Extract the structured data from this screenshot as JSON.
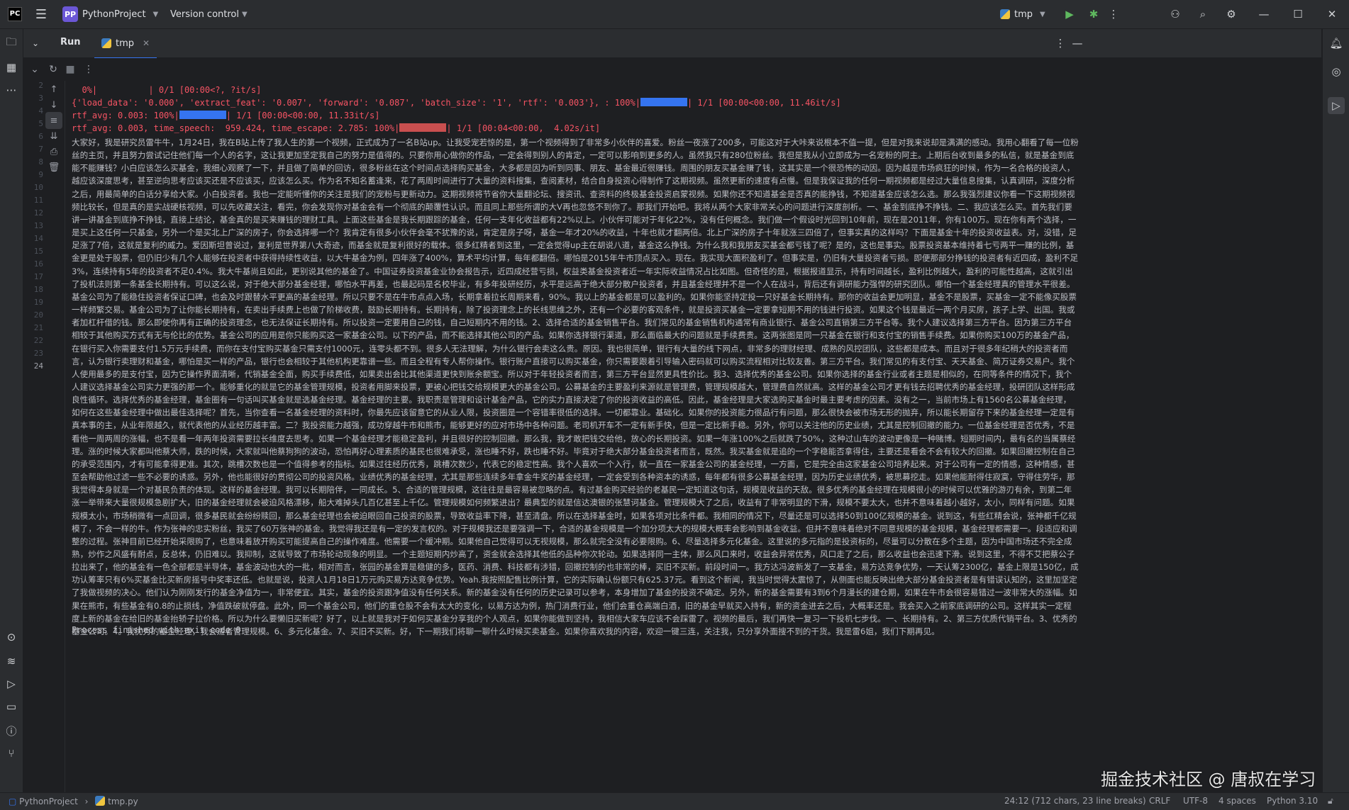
{
  "titlebar": {
    "project_badge": "PP",
    "project_name": "PythonProject",
    "version_control": "Version control",
    "run_config": "tmp"
  },
  "toolwindow": {
    "title": "Run",
    "tab_label": "tmp"
  },
  "line_numbers": [
    "2",
    "3",
    "4",
    "5",
    "6",
    "7",
    "8",
    "9",
    "10",
    "11",
    "12",
    "13",
    "14",
    "15",
    "16",
    "17",
    "18",
    "19",
    "20",
    "21",
    "22",
    "23",
    "24"
  ],
  "console": {
    "progress_line": "  0%|          | 0/1 [00:00<?, ?it/s]",
    "dict_line": "{'load_data': '0.000', 'extract_feat': '0.007', 'forward': '0.087', 'batch_size': '1', 'rtf': '0.003'}, : 100%|",
    "dict_line_end": "| 1/1 [00:00<00:00, 11.46it/s]",
    "rtf_line_1": "rtf_avg: 0.003: 100%|",
    "rtf_line_1_end": "| 1/1 [00:00<00:00, 11.33it/s]",
    "rtf_line_2": "rtf_avg: 0.003, time_speech:  959.424, time_escape: 2.785: 100%|",
    "rtf_line_2_end": "| 1/1 [00:04<00:00,  4.02s/it]",
    "transcript": "大家好，我是研究员雷牛牛，1月24日，我在B站上传了我人生的第一个视频，正式成为了一名B站up。让我受宠若惊的是，第一个视频得到了非常多小伙伴的喜爱。粉丝一夜涨了200多，可能这对于大咔来说根本不值一提，但是对我来说却是满满的感动。我用心翻看了每一位粉丝的主页，并且努力尝试记住他们每一个人的名字，这让我更加坚定我自己的努力是值得的。只要你用心做你的作品，一定会得到别人的肯定，一定可以影响到更多的人。虽然我只有280位粉丝。我但是我从小立即成为一名宠粉的阿主。上期后台收到最多的私信，就是基金到底能不能赚钱？小白应该怎么买基金，我细心观察了一下，并且做了简单的回访，很多粉丝在这个时间点选择购买基金，大多都是因为听到同事、朋友、基金最近很赚钱。周围的朋友买基金赚了钱，这其实是一个很恐怖的动因。因为越是市场疯狂的时候，作为一名合格的投资人，越应该深度思考，甚至逆向思考应该买还是不应该买，应该怎么买。作为名不知名蓄逢来，花了两周时间进行了大量的资料搜集，查阅素材，结合自身投资心得制作了这期视频。虽然更新的速度有点慢。但是我保证我的任何一期视频都是经过大量信息搜集，认真调研，深度分析之后，用最简单的白话分享给大家。小白投资者。我也一定能听懂你的关注是我们的宠粉与更新动力。这期视频将节省你大量翻论坛、搜资讯、查资料的终极基金投资启蒙视频。如果你还不知道基金是否真的能挣钱，不知道基金应该怎么选。那么我强烈建议你看一下这期视频视频比较长，但是真的是实战硬核视频，可以先收藏关注，看完，你会发现你对基金会有一个彻底的颠覆性认识。而且同上那些所谓的大V再也忽悠不到你了。那我们开始吧。我将从两个大家非常关心的问题进行深度剖析。一、基金到底挣不挣钱。二、我应该怎么买。首先我们要讲一讲基金到底挣不挣钱，直接上结论，基金真的是买来赚钱的理财工具。上面这些基金是我长期跟踪的基金，任何一支年化收益都有22%以上。小伙伴可能对于年化22%，没有任何概念。我们做一个假设时光回到10年前，现在是2011年，你有100万。现在你有两个选择，一是买上这任何一只基金，另外一个是买北上广深的房子，你会选择哪一个？我肯定有很多小伙伴会毫不犹豫的说，肯定是房子呀，基金一年才20%的收益，十年也就才翻两倍。北上广深的房子十年就涨三四倍了，但事实真的这样吗？下面是基金十年的投资收益表。对，没错，足足涨了7倍，这就是复利的威力。爱因斯坦曾说过，复利是世界第八大奇迹，而基金就是复利很好的载体。很多红精者到这里，一定会觉得up主在胡说八道，基金这么挣钱。为什么我和我朋友买基金都亏钱了呢？是的，这也是事实。股票投资基本维持着七亏两平一赚的比例，基金更是处于股票，但仍旧少有几个人能够在投资者中获得持续性收益，以大牛基金为例，四年涨了400%，算术平均计算，每年都翻倍。哪怕是2015年牛市顶点买入。现在。我实现大面积盈利了。但事实是，仍旧有大量投资者亏损。即便那部分挣钱的投资者有近四成，盈利不足3%，连续持有5年的投资者不足0.4%。我大牛基尚且如此，更别说其他的基金了。中国证券投资基金业协会报告示，近四成经营亏损，权益类基金投资者近一年实际收益情况占比如图。但奇怪的是，根据报道显示，持有时间越长，盈利比例越大，盈利的可能性越高，这就引出了投机法则第一条基金长期持有。可以这么说，对于绝大部分基金经理，哪怕水平再差，也最起码是名校毕业，有多年投研经历，水平是远高于绝大部分散户投资者，并且基金经理并不是一个人在战斗，背后还有调研能力强悍的研究团队。哪怕一个基金经理真的管理水平很差。基金公司为了能稳住投资者保证口碑，也会及时跟替水平更高的基金经理。所以只要不是在牛市点点入场，长期拿着拉长周期来看，90%。我以上的基金都是可以盈利的。如果你能坚持定投一只好基金长期持有。那你的收益会更加明显，基金不是股票，买基金一定不能像买股票一样频繁交易。基金公司为了让你能长期持有，在卖出手续费上也做了阶梯收费，鼓励长期持有。长期持有，除了投资理念上的长线思维之外，还有一个必要的客观条件，就是投资买基金一定要拿短期不用的钱进行投资。如果这个钱是最近一两个月买房，孩子上学、出国。我或者加杠杆借的钱。那么即使你再有正确的投资理念，也无法保证长期持有。所以投资一定要用自己的钱，自己短期内不用的钱。2、选择合适的基金销售平台。我们常见的基金销售机构通常有商业银行、基金公司直销第三方平台等。我个人建议选择第三方平台。因为第三方平台相较于其他购买方式有无与伦比的优势。基金公司的应用是你只能购买这一家基金公司。以下的产品，而不能选择其他公司的产品。如果你选择银行渠道，那么面临最大的问题就是手续费贵。这两张图是同一只基金在银行和支付宝的销售手续费。如果你购买100万的基金产品，在银行买入你需要支付1.5万元手续费，而你在支付宝购买基金只需支付1000元，连零头都不到。很多人无法理解，为什么银行会卖这么贵。原因。我也很简单，银行有大量的线下网点，非常多的理财经理、成熟的风控团队，这些都是成本。而且对于很多年纪稍大的投资者而言，认为银行卖理财和基金，哪怕是买一样的产品，银行也会相较于其他机构更靠谱一些。而且全程有专人帮你操作。银行账户直接可以购买基金，你只需要跟着引导输入密码就可以购买流程相对比较友善。第三方平台。我们常见的有支付宝、天天基金、简万证券交易户。我个人使用最多的是支付宝，因为它操作界面清晰，代销基金全面，购买手续费低，如果卖出会比其他渠道更快到账余额宝。所以对于年轻投资者而言，第三方平台显然更具性价比。我3、选择优秀的基金公司。如果你选择的基金行业或者主题是相似的，在同等条件的情况下，我个人建议选择基金公司实力更强的那一个。能够重化的就是它的基金管理规模，投资者用脚来投票，更被心把钱交给规模更大的基金公司。公募基金的主要盈利来源就是管理费，管理规模越大，管理费自然就高。这样的基金公司才更有钱去招聘优秀的基金经理，投研团队这样形成良性循环。选择优秀的基金经理，基金圈有一句话叫买基金就是选基金经理。基金经理的主要。我职责是管理和设计基金产品，它的实力直接决定了你的投资收益的高低。因此，基金经理是大家选购买基金时最主要考虑的因素。没有之一，当前市场上有1560名公募基金经理，如何在这些基金经理中做出最佳选择呢？首先，当你查看一名基金经理的资料时，你最先应该留意它的从业人限，投资圈是一个容错率很低的选择。一切都靠业。基础化。如果你的投资能力很品行有问题，那么很快会被市场无形的抛弃，所以能长期留存下来的基金经理一定是有真本事的主，从业年限越久，就代表他的从业经历越丰富。二？我投资能力越强，成功穿越牛市和熊市，能够更好的应对市场中各种问题。老司机开车不一定有新手快，但是一定比新手稳。另外，你可以关注他的历史业绩，尤其是控制回撤的能力。一位基金经理是否优秀，不是看他一周两周的涨幅，也不是看一年两年投资需要拉长维度去思考。如果一个基金经理才能稳定盈利，并且很好的控制回撤。那么我，我才敢把钱交给他，放心的长期投资。如果一年涨100%之后就跌了50%，这种过山车的波动更像是一种赌博。短期时间内，最有名的当属蔡经理。涨的时候大家都叫他蔡大师，跌的时候，大家就叫他蔡狗狗的波动，恐怕再好心理素质的基民也很难承受，涨也睡不好，跌也睡不好。毕竟对于绝大部分基金投资者而言，既然。我买基金就是追的一个字稳能否拿得住，主要还是看会不会有较大的回撤。如果回撤控制在自己的承受范围内，才有可能拿得更准。其次，跳槽次数也是一个值得参考的指标。如果过往经历优秀，跳槽次数少，代表它的稳定性高。我个人喜欢一个入行，就一直在一家基金公司的基金经理，一方面，它是完全由这家基金公司培养起来。对于公司有一定的情感，这种情感，甚至会帮助他过滤一些不必要的诱惑。另外，他也能很好的贯彻公司的投资风格。业绩优秀的基金经理，尤其是那些连续多年拿金牛奖的基金经理，一定会受到各种资本的诱惑，每年都有很多公募基金经理，因为历史业绩优秀，被思募挖走。如果他能耐得住寂寞，守得住劳华，那我觉得本身就是一个对基民负责的体现。这样的基金经理。我可以长期陪伴，一同成长。5、合适的管理规模，这往往是最容易被忽略的点。有过基金购买经验的老基民一定知道这句话，规模是收益的天敌。很多优秀的基金经理在规模很小的时候可以优雅的游刃有余，到第二年涨一举带来大量很规模急剧扩大，旧的基金经理就会被迫风格漂移，船大难掉头几百亿甚至上千亿。管理规模如何频繁进出？最典型的就是信达澳银的张慧诃基金。管理规模大了之后，收益有了非常明显的下滑，规模不要太大，也并不意味着越小越好，太小，同样有问题。如果规模太小，市场稍微有一点回调，很多基民就会纷纷赎回，那么基金经理也会被迫眼回自己投资的股票，导致收益率下降，甚至清盘。所以在选择基金时，如果各项对比条件都。我相同的情况下，尽量还是可以选择50到100亿规模的基金。说到这，有些红精会说，张神都千亿规模了，不会一样的牛。作为张神的忠实粉丝，我买了60万张神的基金。我觉得我还是有一定的发言权的。对于规模我还是要强调一下，合适的基金规模是一个加分项太大的规模大概率会影响到基金收益。但并不意味着绝对不同意规模的基金规模，基金经理都需要一。段适应和调整的过程。张神目前已经开始采限购了，也意味着放开购买可能提高自己的操作难度。他需要一个缓冲期。如果他自己觉得可以无视规模，那么就完全没有必要限购。6、尽量选择多元化基金。这里说的多元指的是投资标的，尽量可以分散在多个主题，因为中国市场还不完全成熟，炒作之风盛有耐点，反总体，仍旧难以。我抑制，这就导致了市场轮动现象的明显。一个主题短期内炒高了，资金就会选择其他低的品种你次轮动。如果选择同一主体，那么风口来时，收益会异常优秀，风口走了之后，那么收益也会迅速下滑。说到这里，不得不艾把蔡公子拉出来了，他的基金有一色全部都是半导体，基金波动也大的一批，相对而言，张园的基金算是稳健的多，医药、消费、科技都有涉猎，回撤控制的也非常的棒，买旧不买新。前段时间一。我方达冯波新发了一支基金，易方达竞争优势，一天认筹2300亿，基金上限是150亿，成功认筹率只有6%买基金比买新房摇号中奖率还低。也就是说，投资人1月18日1万元购买易方达竞争优势。Yeah.我按照配售比例计算，它的实际确认份额只有625.37元。看到这个新闻，我当时觉得太震惊了，从侧面也能反映出绝大部分基金投资者是有错误认知的，这里加坚定了我做视频的决心。他们认为刚刚发行的基金净值为一，非常便宜。其实，基金的投资跟净值没有任何关系。新的基金没有任何的历史记录可以参考，本身增加了基金的投资不确定。另外，新的基金需要有3到6个月漫长的建仓期，如果在牛市会很容易错过一波非常大的涨幅。如果在熊市，有些基金有0.8的止损线，净值跌破就停盘。此外，同一个基金公司，他们的重仓股不会有太大的变化，以易方达为例，热门消费行业，他们会重仓高端白酒，旧的基金早就买入持有，新的资金进去之后，大概率还是。我会买入之前家底调研的公司。这样其实一定程度上新的基金在给旧的基金抬轿子拉价格。所以为什么要懒旧买新呢？好了，以上就是我对于如何买基金分享我的个人观点，如果你能做到坚持，我相信大家车应该不会踩雷了。视频的最后，我们再快一复习一下投机七步伐。一、长期持有。2、第三方优质代销平台。3、优秀的基金公司。4。我优秀的基金经理，我会适者管理规模。6、多元化基金。7、买旧不买新。好，下一期我们将聊一聊什么时候买卖基金。如果你喜欢我的内容，欢迎一键三连，关注我，只分享外面搜不到的干货。我是雷6姐，我们下期再见。",
    "exit_line": "Process finished with exit code 0"
  },
  "watermark": "掘金技术社区 @ 唐叔在学习",
  "statusbar": {
    "breadcrumb_project": "PythonProject",
    "breadcrumb_file": "tmp.py",
    "position": "24:12 (712 chars, 23 line breaks)",
    "line_ending": "CRLF",
    "encoding": "UTF-8",
    "indent": "4 spaces",
    "interpreter": "Python 3.10"
  },
  "colors": {
    "accent": "#3574f0",
    "error_text": "#f75464",
    "progress_red": "#c94f4f"
  }
}
